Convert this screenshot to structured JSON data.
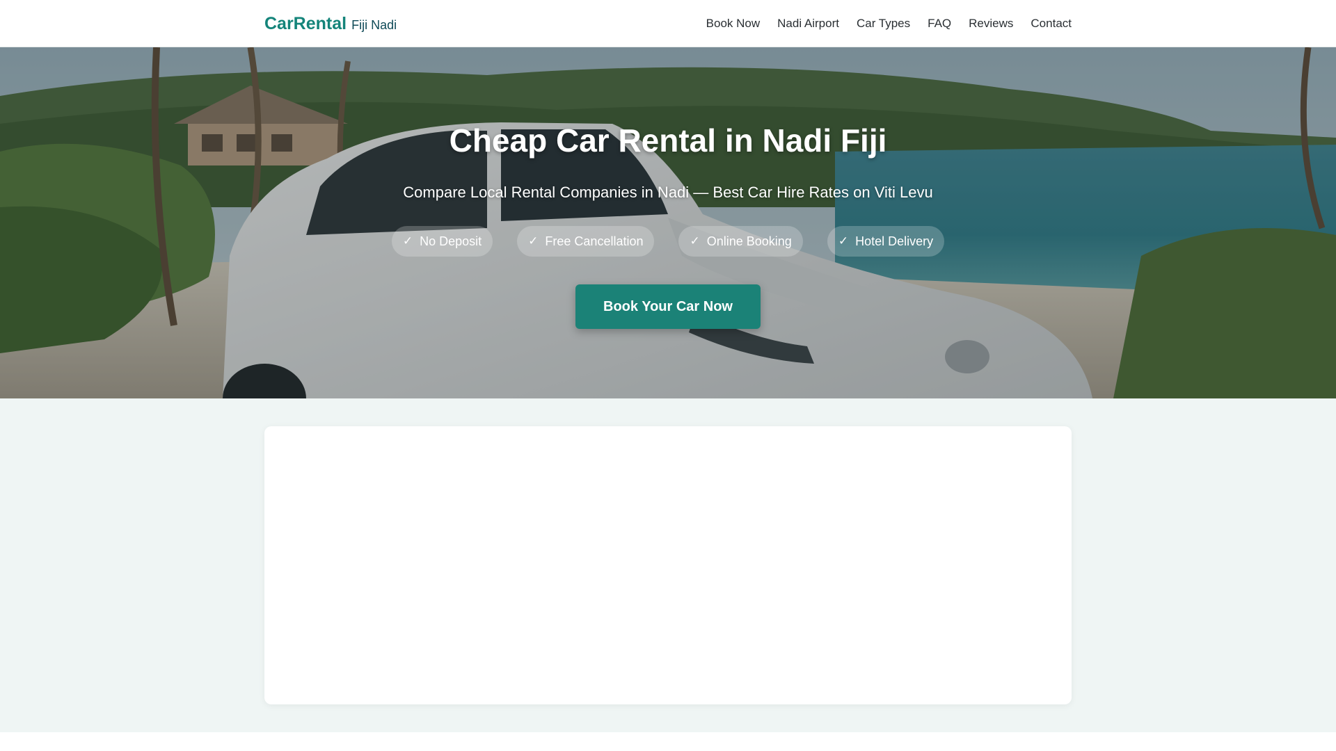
{
  "brand": {
    "name": "CarRental",
    "location": "Fiji Nadi"
  },
  "nav": {
    "items": [
      {
        "label": "Book Now",
        "name": "nav-book-now"
      },
      {
        "label": "Nadi Airport",
        "name": "nav-nadi-airport"
      },
      {
        "label": "Car Types",
        "name": "nav-car-types"
      },
      {
        "label": "FAQ",
        "name": "nav-faq"
      },
      {
        "label": "Reviews",
        "name": "nav-reviews"
      },
      {
        "label": "Contact",
        "name": "nav-contact"
      }
    ]
  },
  "hero": {
    "title": "Cheap Car Rental in Nadi Fiji",
    "subtitle": "Compare Local Rental Companies in Nadi — Best Car Hire Rates on Viti Levu",
    "badges": [
      {
        "icon": "check-icon",
        "check": "✓",
        "label": "No Deposit"
      },
      {
        "icon": "check-icon",
        "check": "✓",
        "label": "Free Cancellation"
      },
      {
        "icon": "check-icon",
        "check": "✓",
        "label": "Online Booking"
      },
      {
        "icon": "check-icon",
        "check": "✓",
        "label": "Hotel Delivery"
      }
    ],
    "cta_label": "Book Your Car Now"
  },
  "colors": {
    "brand": "#14847a",
    "brand_sub": "#0f4a57",
    "cta": "#1b8277",
    "section_bg": "#eff5f4"
  }
}
